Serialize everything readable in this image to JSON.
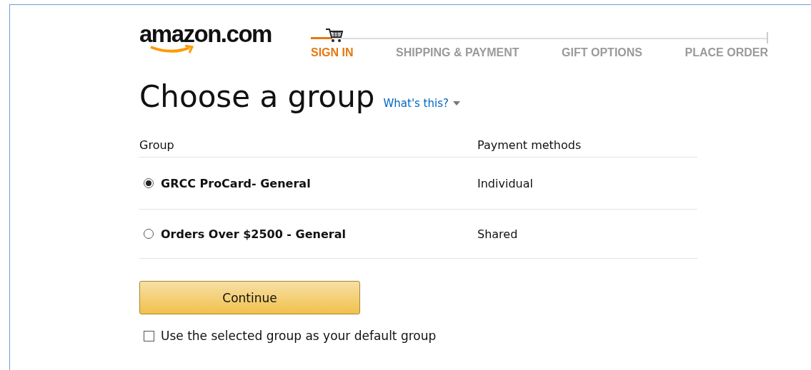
{
  "logo": "amazon.com",
  "steps": [
    {
      "label": "SIGN IN",
      "selected": true
    },
    {
      "label": "SHIPPING & PAYMENT",
      "selected": false
    },
    {
      "label": "GIFT OPTIONS",
      "selected": false
    },
    {
      "label": "PLACE ORDER",
      "selected": false
    }
  ],
  "heading": "Choose a group",
  "help_link": "What's this?",
  "table": {
    "columns": [
      "Group",
      "Payment methods"
    ],
    "rows": [
      {
        "group": "GRCC ProCard- General",
        "payment": "Individual",
        "selected": true
      },
      {
        "group": "Orders Over $2500 - General",
        "payment": "Shared",
        "selected": false
      }
    ]
  },
  "continue_button": "Continue",
  "default_checkbox": {
    "label": "Use the selected group as your default group",
    "checked": false
  }
}
